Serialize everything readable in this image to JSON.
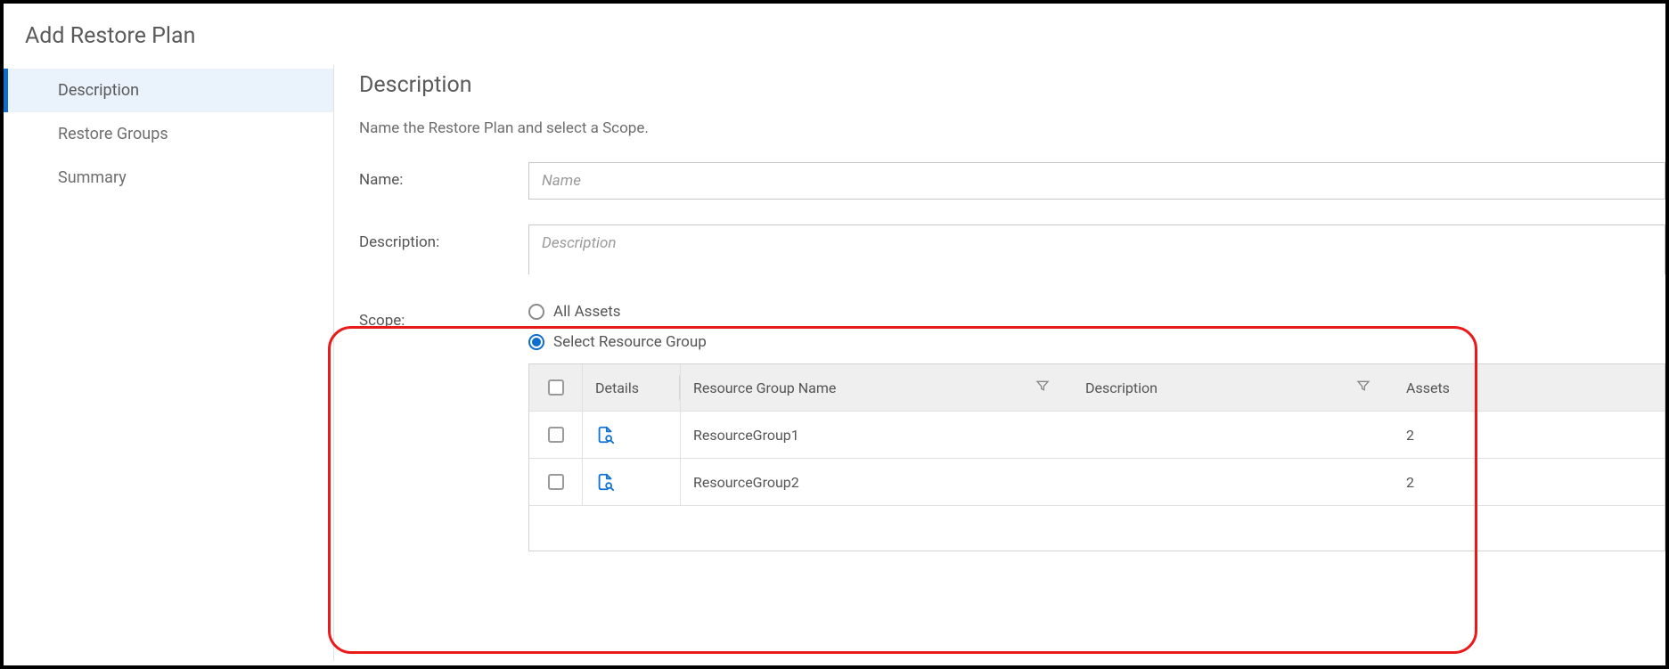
{
  "page_title": "Add Restore Plan",
  "sidebar": {
    "items": [
      {
        "label": "Description",
        "active": true
      },
      {
        "label": "Restore Groups",
        "active": false
      },
      {
        "label": "Summary",
        "active": false
      }
    ]
  },
  "main": {
    "heading": "Description",
    "subheading": "Name the Restore Plan and select a Scope.",
    "fields": {
      "name": {
        "label": "Name:",
        "placeholder": "Name",
        "value": ""
      },
      "description": {
        "label": "Description:",
        "placeholder": "Description",
        "value": ""
      },
      "scope": {
        "label": "Scope:",
        "options": {
          "all_assets": "All Assets",
          "select_resource_group": "Select Resource Group"
        },
        "selected": "select_resource_group"
      }
    },
    "table": {
      "columns": {
        "details": "Details",
        "resource_group_name": "Resource Group Name",
        "description": "Description",
        "assets": "Assets"
      },
      "rows": [
        {
          "name": "ResourceGroup1",
          "description": "",
          "assets": "2",
          "checked": false
        },
        {
          "name": "ResourceGroup2",
          "description": "",
          "assets": "2",
          "checked": false
        }
      ]
    }
  }
}
